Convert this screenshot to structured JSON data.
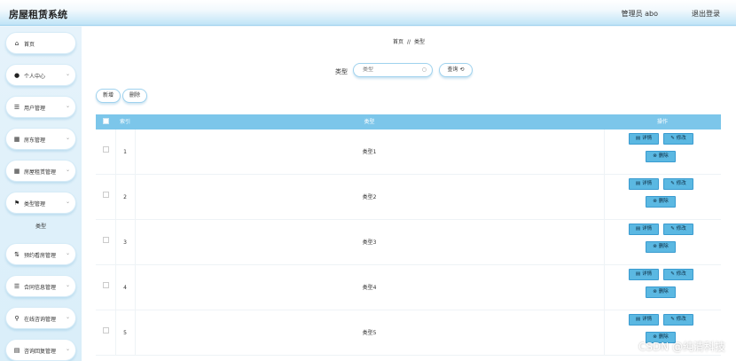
{
  "header": {
    "title": "房屋租赁系统",
    "user": "管理员 abo",
    "logout": "退出登录"
  },
  "sidebar": {
    "items": [
      {
        "label": "首页",
        "icon": "home-icon",
        "glyph": "⌂"
      },
      {
        "label": "个人中心",
        "icon": "user-icon",
        "glyph": "●"
      },
      {
        "label": "用户管理",
        "icon": "list-icon",
        "glyph": "☰"
      },
      {
        "label": "房东管理",
        "icon": "grid-icon",
        "glyph": "▦"
      },
      {
        "label": "房屋租赁管理",
        "icon": "grid-icon",
        "glyph": "▦"
      },
      {
        "label": "类型管理",
        "icon": "flag-icon",
        "glyph": "⚑"
      },
      {
        "label": "预约看房管理",
        "icon": "sort-icon",
        "glyph": "⇅"
      },
      {
        "label": "合同信息管理",
        "icon": "list-icon",
        "glyph": "☰"
      },
      {
        "label": "在线咨询管理",
        "icon": "pin-icon",
        "glyph": "⚲"
      },
      {
        "label": "咨询回复管理",
        "icon": "book-icon",
        "glyph": "▤"
      }
    ],
    "sub_item": "类型",
    "chevron": "⌄"
  },
  "breadcrumb": {
    "home": "首页",
    "sep": "//",
    "current": "类型"
  },
  "search": {
    "label": "类型",
    "placeholder": "类型",
    "button": "查询 ⟲"
  },
  "toolbar": {
    "add": "新增",
    "delete": "删除"
  },
  "table": {
    "headers": [
      "索引",
      "类型",
      "操作"
    ],
    "rows": [
      {
        "index": "1",
        "type": "类型1"
      },
      {
        "index": "2",
        "type": "类型2"
      },
      {
        "index": "3",
        "type": "类型3"
      },
      {
        "index": "4",
        "type": "类型4"
      },
      {
        "index": "5",
        "type": "类型5"
      }
    ],
    "actions": {
      "detail": "详情",
      "edit": "修改",
      "delete": "删除",
      "detail_glyph": "▤",
      "edit_glyph": "✎",
      "delete_glyph": "⊗"
    }
  },
  "watermark": "CSDN @纯清科技",
  "colors": {
    "header_accent": "#bfe4f7",
    "table_header": "#7cc6ea",
    "action_button": "#5bb8e2"
  }
}
